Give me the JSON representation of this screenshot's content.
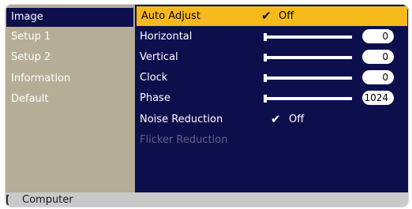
{
  "sidebar": {
    "items": [
      {
        "label": "Image",
        "selected": true
      },
      {
        "label": "Setup 1",
        "selected": false
      },
      {
        "label": "Setup 2",
        "selected": false
      },
      {
        "label": "Information",
        "selected": false
      },
      {
        "label": "Default",
        "selected": false
      }
    ]
  },
  "main": {
    "rows": [
      {
        "label": "Auto Adjust",
        "check": "✔",
        "value": "Off"
      },
      {
        "label": "Horizontal",
        "value": "0",
        "slider_fraction": 0.0
      },
      {
        "label": "Vertical",
        "value": "0",
        "slider_fraction": 0.0
      },
      {
        "label": "Clock",
        "value": "0",
        "slider_fraction": 0.0
      },
      {
        "label": "Phase",
        "value": "1024",
        "slider_fraction": 0.0
      },
      {
        "label": "Noise Reduction",
        "check": "✔",
        "value": "Off"
      },
      {
        "label": "Flicker Reduction"
      }
    ]
  },
  "footer": {
    "label": "Computer"
  },
  "colors": {
    "menu_bg": "#0d0f4d",
    "highlight": "#f7ba1b",
    "sidebar_bg": "#b6ad97",
    "disabled_text": "#5f6382"
  }
}
